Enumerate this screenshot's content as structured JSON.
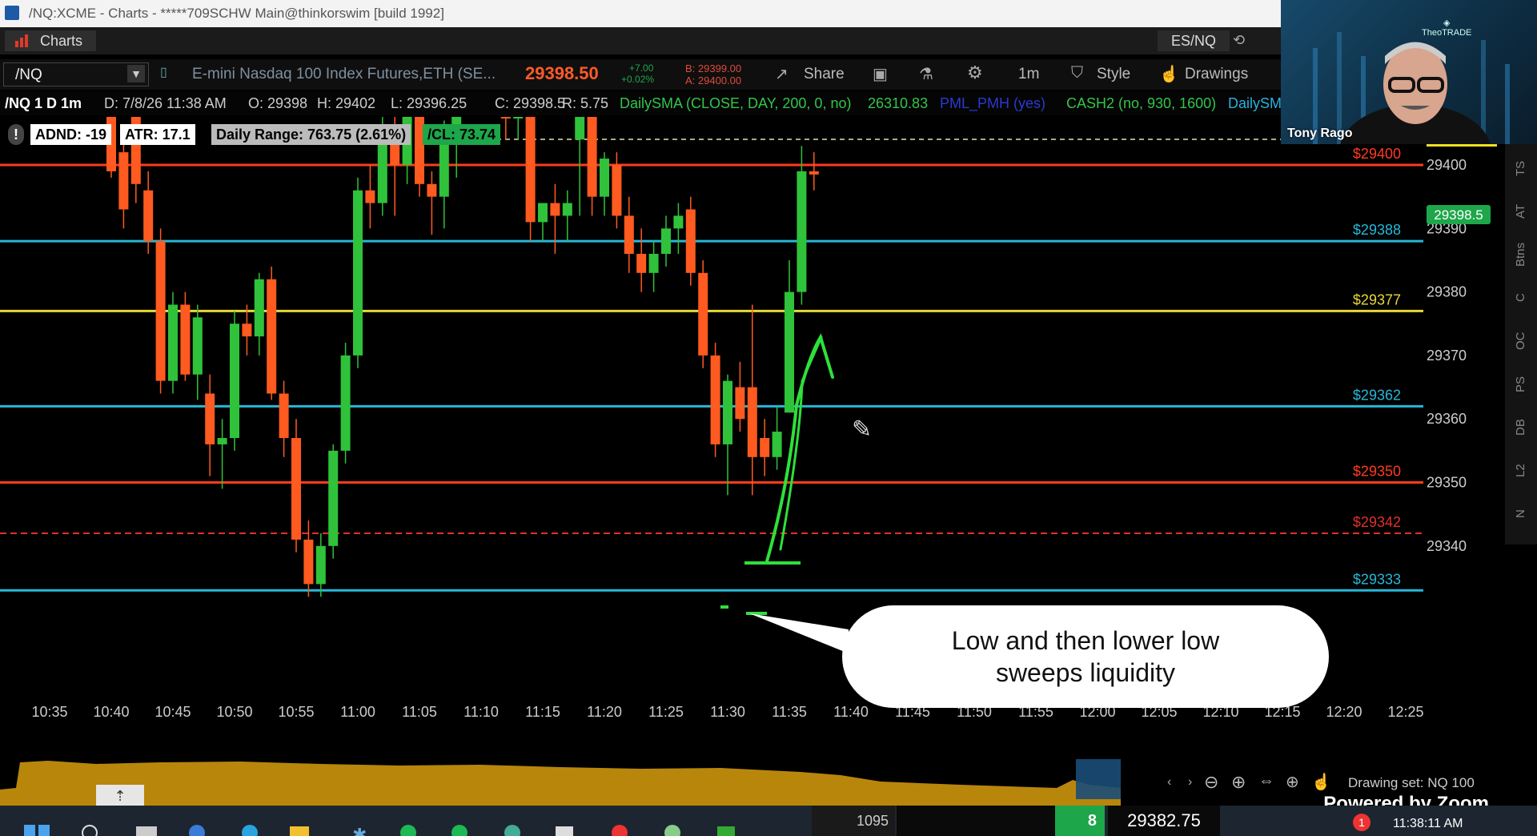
{
  "window": {
    "title": "/NQ:XCME - Charts - *****709SCHW Main@thinkorswim [build 1992]"
  },
  "tabs": {
    "charts_label": "Charts",
    "right_symbol": "ES/NQ"
  },
  "toolbar": {
    "symbol": "/NQ",
    "description": "E-mini Nasdaq 100 Index Futures,ETH (SE...",
    "last_price": "29398.50",
    "change_abs": "+7.00",
    "change_pct": "+0.02%",
    "bid": "B: 29399.00",
    "ask": "A: 29400.00",
    "share_label": "Share",
    "timeframe_label": "1m",
    "style_label": "Style",
    "drawings_label": "Drawings"
  },
  "infobar": {
    "symbol_period": "/NQ 1 D 1m",
    "date": "D: 7/8/26 11:38 AM",
    "open": "O: 29398",
    "high": "H: 29402",
    "low": "L: 29396.25",
    "close": "C: 29398.5",
    "range": "R: 5.75",
    "sma": "DailySMA (CLOSE, DAY, 200, 0, no)",
    "sma_value": "26310.83",
    "pml": "PML_PMH (yes)",
    "cash": "CASH2 (no, 930, 1600)",
    "daily_trunc": "DailySM"
  },
  "badges": {
    "adnd": "ADND: -19",
    "atr": "ATR: 17.1",
    "daily_range": "Daily Range: 763.75 (2.61%)",
    "cl": "/CL: 73.74"
  },
  "chart_data": {
    "type": "candlestick",
    "ylim": [
      29330,
      29412
    ],
    "y_ticks": [
      29340,
      29350,
      29360,
      29370,
      29380,
      29390,
      29400
    ],
    "y_tick_labels": [
      "29340",
      "29350",
      "29360",
      "29370",
      "29380",
      "29390",
      "29400"
    ],
    "x_ticks": [
      "10:35",
      "10:40",
      "10:45",
      "10:50",
      "10:55",
      "11:00",
      "11:05",
      "11:10",
      "11:15",
      "11:20",
      "11:25",
      "11:30",
      "11:35",
      "11:40",
      "11:45",
      "11:50",
      "11:55",
      "12:00",
      "12:05",
      "12:10",
      "12:15",
      "12:20",
      "12:25"
    ],
    "current_price_label": "29398.5",
    "levels": [
      {
        "label": "$29400",
        "value": 29400,
        "color": "#ff3b1f",
        "style": "solid"
      },
      {
        "label": "$29388",
        "value": 29388,
        "color": "#27b7d8",
        "style": "solid"
      },
      {
        "label": "$29377",
        "value": 29377,
        "color": "#e6d83a",
        "style": "solid"
      },
      {
        "label": "$29362",
        "value": 29362,
        "color": "#27b7d8",
        "style": "solid"
      },
      {
        "label": "$29350",
        "value": 29350,
        "color": "#ff3b1f",
        "style": "solid"
      },
      {
        "label": "$29342",
        "value": 29342,
        "color": "#e0302a",
        "style": "dashed"
      },
      {
        "label": "$29333",
        "value": 29333,
        "color": "#27b7d8",
        "style": "solid"
      }
    ],
    "candles": [
      {
        "t": "10:40",
        "o": 29410,
        "h": 29412,
        "l": 29398,
        "c": 29399
      },
      {
        "t": "10:41",
        "o": 29402,
        "h": 29406,
        "l": 29390,
        "c": 29393
      },
      {
        "t": "10:42",
        "o": 29409,
        "h": 29412,
        "l": 29394,
        "c": 29397
      },
      {
        "t": "10:43",
        "o": 29396,
        "h": 29399,
        "l": 29386,
        "c": 29388
      },
      {
        "t": "10:44",
        "o": 29388,
        "h": 29390,
        "l": 29364,
        "c": 29366
      },
      {
        "t": "10:45",
        "o": 29366,
        "h": 29380,
        "l": 29364,
        "c": 29378
      },
      {
        "t": "10:46",
        "o": 29378,
        "h": 29380,
        "l": 29366,
        "c": 29367
      },
      {
        "t": "10:47",
        "o": 29367,
        "h": 29378,
        "l": 29363,
        "c": 29376
      },
      {
        "t": "10:48",
        "o": 29364,
        "h": 29367,
        "l": 29351,
        "c": 29356
      },
      {
        "t": "10:49",
        "o": 29356,
        "h": 29360,
        "l": 29349,
        "c": 29357
      },
      {
        "t": "10:50",
        "o": 29357,
        "h": 29377,
        "l": 29355,
        "c": 29375
      },
      {
        "t": "10:51",
        "o": 29375,
        "h": 29378,
        "l": 29370,
        "c": 29373
      },
      {
        "t": "10:52",
        "o": 29373,
        "h": 29383,
        "l": 29370,
        "c": 29382
      },
      {
        "t": "10:53",
        "o": 29382,
        "h": 29384,
        "l": 29363,
        "c": 29364
      },
      {
        "t": "10:54",
        "o": 29364,
        "h": 29366,
        "l": 29354,
        "c": 29357
      },
      {
        "t": "10:55",
        "o": 29357,
        "h": 29360,
        "l": 29339,
        "c": 29341
      },
      {
        "t": "10:56",
        "o": 29341,
        "h": 29344,
        "l": 29332,
        "c": 29334
      },
      {
        "t": "10:57",
        "o": 29334,
        "h": 29342,
        "l": 29332,
        "c": 29340
      },
      {
        "t": "10:58",
        "o": 29340,
        "h": 29356,
        "l": 29338,
        "c": 29355
      },
      {
        "t": "10:59",
        "o": 29355,
        "h": 29372,
        "l": 29353,
        "c": 29370
      },
      {
        "t": "11:00",
        "o": 29370,
        "h": 29398,
        "l": 29368,
        "c": 29396
      },
      {
        "t": "11:01",
        "o": 29396,
        "h": 29400,
        "l": 29390,
        "c": 29394
      },
      {
        "t": "11:02",
        "o": 29394,
        "h": 29408,
        "l": 29392,
        "c": 29406
      },
      {
        "t": "11:03",
        "o": 29406,
        "h": 29410,
        "l": 29392,
        "c": 29400
      },
      {
        "t": "11:04",
        "o": 29400,
        "h": 29412,
        "l": 29397,
        "c": 29410
      },
      {
        "t": "11:05",
        "o": 29409,
        "h": 29412,
        "l": 29395,
        "c": 29397
      },
      {
        "t": "11:06",
        "o": 29397,
        "h": 29399,
        "l": 29389,
        "c": 29395
      },
      {
        "t": "11:07",
        "o": 29395,
        "h": 29407,
        "l": 29390,
        "c": 29404
      },
      {
        "t": "11:08",
        "o": 29404,
        "h": 29412,
        "l": 29398,
        "c": 29410
      },
      {
        "t": "11:12",
        "o": 29410,
        "h": 29412,
        "l": 29404,
        "c": 29408
      },
      {
        "t": "11:13",
        "o": 29408,
        "h": 29412,
        "l": 29404,
        "c": 29409
      },
      {
        "t": "11:14",
        "o": 29410,
        "h": 29412,
        "l": 29388,
        "c": 29391
      },
      {
        "t": "11:15",
        "o": 29391,
        "h": 29393,
        "l": 29388,
        "c": 29394
      },
      {
        "t": "11:16",
        "o": 29394,
        "h": 29397,
        "l": 29386,
        "c": 29392
      },
      {
        "t": "11:17",
        "o": 29392,
        "h": 29396,
        "l": 29388,
        "c": 29394
      },
      {
        "t": "11:18",
        "o": 29404,
        "h": 29412,
        "l": 29392,
        "c": 29410
      },
      {
        "t": "11:19",
        "o": 29410,
        "h": 29412,
        "l": 29392,
        "c": 29395
      },
      {
        "t": "11:20",
        "o": 29395,
        "h": 29402,
        "l": 29392,
        "c": 29401
      },
      {
        "t": "11:21",
        "o": 29400,
        "h": 29402,
        "l": 29390,
        "c": 29392
      },
      {
        "t": "11:22",
        "o": 29392,
        "h": 29395,
        "l": 29383,
        "c": 29386
      },
      {
        "t": "11:23",
        "o": 29386,
        "h": 29390,
        "l": 29380,
        "c": 29383
      },
      {
        "t": "11:24",
        "o": 29383,
        "h": 29388,
        "l": 29380,
        "c": 29386
      },
      {
        "t": "11:25",
        "o": 29386,
        "h": 29392,
        "l": 29384,
        "c": 29390
      },
      {
        "t": "11:26",
        "o": 29390,
        "h": 29394,
        "l": 29386,
        "c": 29392
      },
      {
        "t": "11:27",
        "o": 29393,
        "h": 29395,
        "l": 29381,
        "c": 29383
      },
      {
        "t": "11:28",
        "o": 29383,
        "h": 29385,
        "l": 29368,
        "c": 29370
      },
      {
        "t": "11:29",
        "o": 29370,
        "h": 29372,
        "l": 29354,
        "c": 29356
      },
      {
        "t": "11:30",
        "o": 29356,
        "h": 29367,
        "l": 29348,
        "c": 29366
      },
      {
        "t": "11:31",
        "o": 29365,
        "h": 29369,
        "l": 29358,
        "c": 29360
      },
      {
        "t": "11:32",
        "o": 29365,
        "h": 29378,
        "l": 29348,
        "c": 29354
      },
      {
        "t": "11:33",
        "o": 29357,
        "h": 29360,
        "l": 29351,
        "c": 29354
      },
      {
        "t": "11:34",
        "o": 29354,
        "h": 29362,
        "l": 29352,
        "c": 29358
      },
      {
        "t": "11:35",
        "o": 29361,
        "h": 29385,
        "l": 29361,
        "c": 29380
      },
      {
        "t": "11:36",
        "o": 29380,
        "h": 29403,
        "l": 29378,
        "c": 29399
      },
      {
        "t": "11:37",
        "o": 29399,
        "h": 29402,
        "l": 29396,
        "c": 29398.5
      }
    ]
  },
  "annotation": {
    "text_line1": "Low and then lower low",
    "text_line2": "sweeps liquidity"
  },
  "sidetabs": [
    "TS",
    "AT",
    "Btns",
    "C",
    "OC",
    "PS",
    "DB",
    "L2",
    "N"
  ],
  "bottom": {
    "drawing_set": "Drawing set: NQ 100",
    "powered_by": "Powered by Zoom"
  },
  "webcam": {
    "name": "Tony Rago",
    "logo": "TheoTRADE"
  },
  "taskbar": {
    "value1": "1095",
    "value2": "8",
    "value3": "29382.75",
    "clock": "11:38:11 AM",
    "notif": "1"
  }
}
